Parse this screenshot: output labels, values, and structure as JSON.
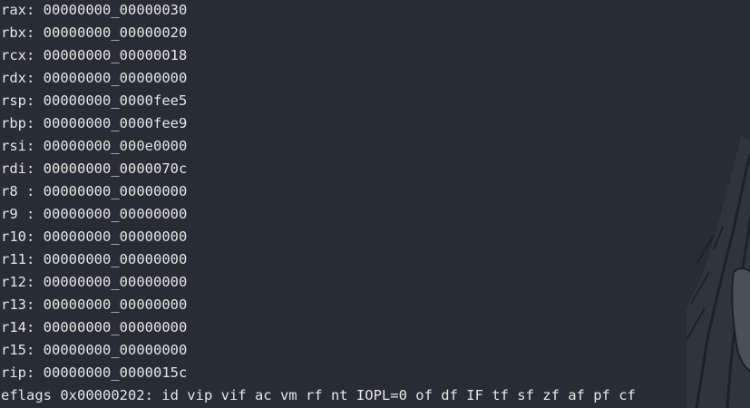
{
  "terminal": {
    "registers": [
      {
        "name": "rax",
        "value": "00000000_00000030"
      },
      {
        "name": "rbx",
        "value": "00000000_00000020"
      },
      {
        "name": "rcx",
        "value": "00000000_00000018"
      },
      {
        "name": "rdx",
        "value": "00000000_00000000"
      },
      {
        "name": "rsp",
        "value": "00000000_0000fee5"
      },
      {
        "name": "rbp",
        "value": "00000000_0000fee9"
      },
      {
        "name": "rsi",
        "value": "00000000_000e0000"
      },
      {
        "name": "rdi",
        "value": "00000000_0000070c"
      },
      {
        "name": "r8 ",
        "value": "00000000_00000000"
      },
      {
        "name": "r9 ",
        "value": "00000000_00000000"
      },
      {
        "name": "r10",
        "value": "00000000_00000000"
      },
      {
        "name": "r11",
        "value": "00000000_00000000"
      },
      {
        "name": "r12",
        "value": "00000000_00000000"
      },
      {
        "name": "r13",
        "value": "00000000_00000000"
      },
      {
        "name": "r14",
        "value": "00000000_00000000"
      },
      {
        "name": "r15",
        "value": "00000000_00000000"
      },
      {
        "name": "rip",
        "value": "00000000_0000015c"
      }
    ],
    "eflags_line": "eflags 0x00000202: id vip vif ac vm rf nt IOPL=0 of df IF tf sf zf af pf cf"
  },
  "colors": {
    "background": "#282c34",
    "text": "#e6e6e6",
    "art_fill": "#3a3f47",
    "art_stroke": "#1e2126"
  },
  "decorations": {
    "background_art_icon": "hooded-figure-icon"
  }
}
